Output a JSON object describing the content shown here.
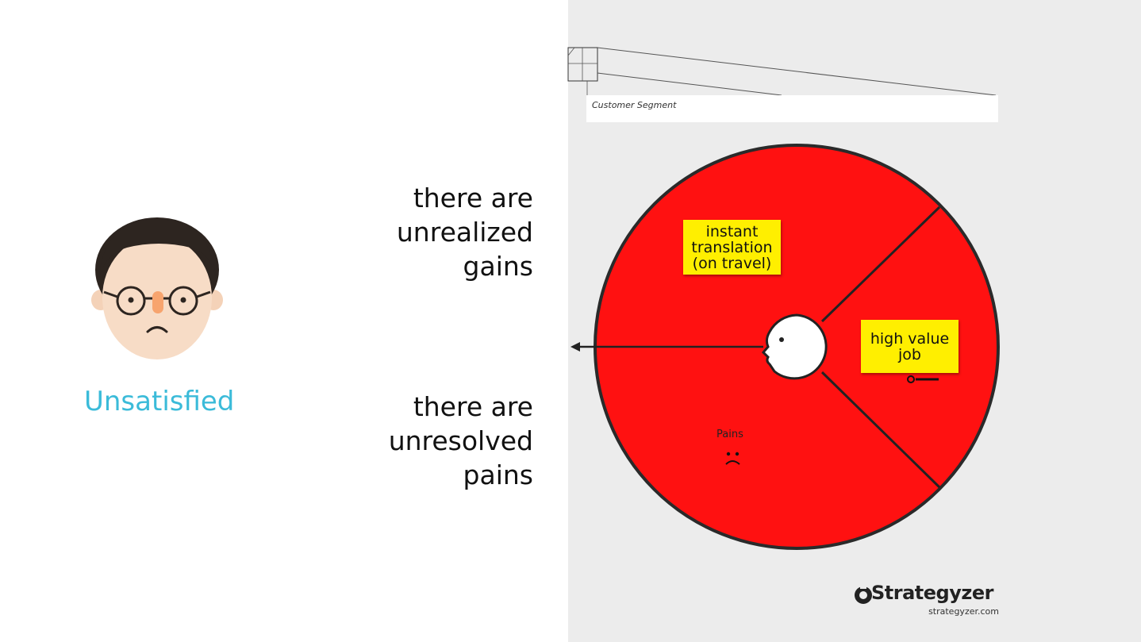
{
  "persona": {
    "label": "Unsatisfied",
    "icon": "unsatisfied-face-icon"
  },
  "statements": {
    "gains": [
      "there are",
      "unrealized",
      "gains"
    ],
    "pains": [
      "there are",
      "unresolved",
      "pains"
    ]
  },
  "canvas": {
    "segment_label": "Customer Segment",
    "gain_note": [
      "instant",
      "translation",
      "(on travel)"
    ],
    "job_note": [
      "high value",
      "job"
    ],
    "pains_label": "Pains",
    "colors": {
      "circle_fill": "#ff1111",
      "note_fill": "#ffef00",
      "right_panel_bg": "#ececec",
      "accent_label": "#3bbbd9"
    }
  },
  "brand": {
    "name": "Strategyzer",
    "url": "strategyzer.com",
    "logo_icon": "strategyzer-logo-icon"
  }
}
